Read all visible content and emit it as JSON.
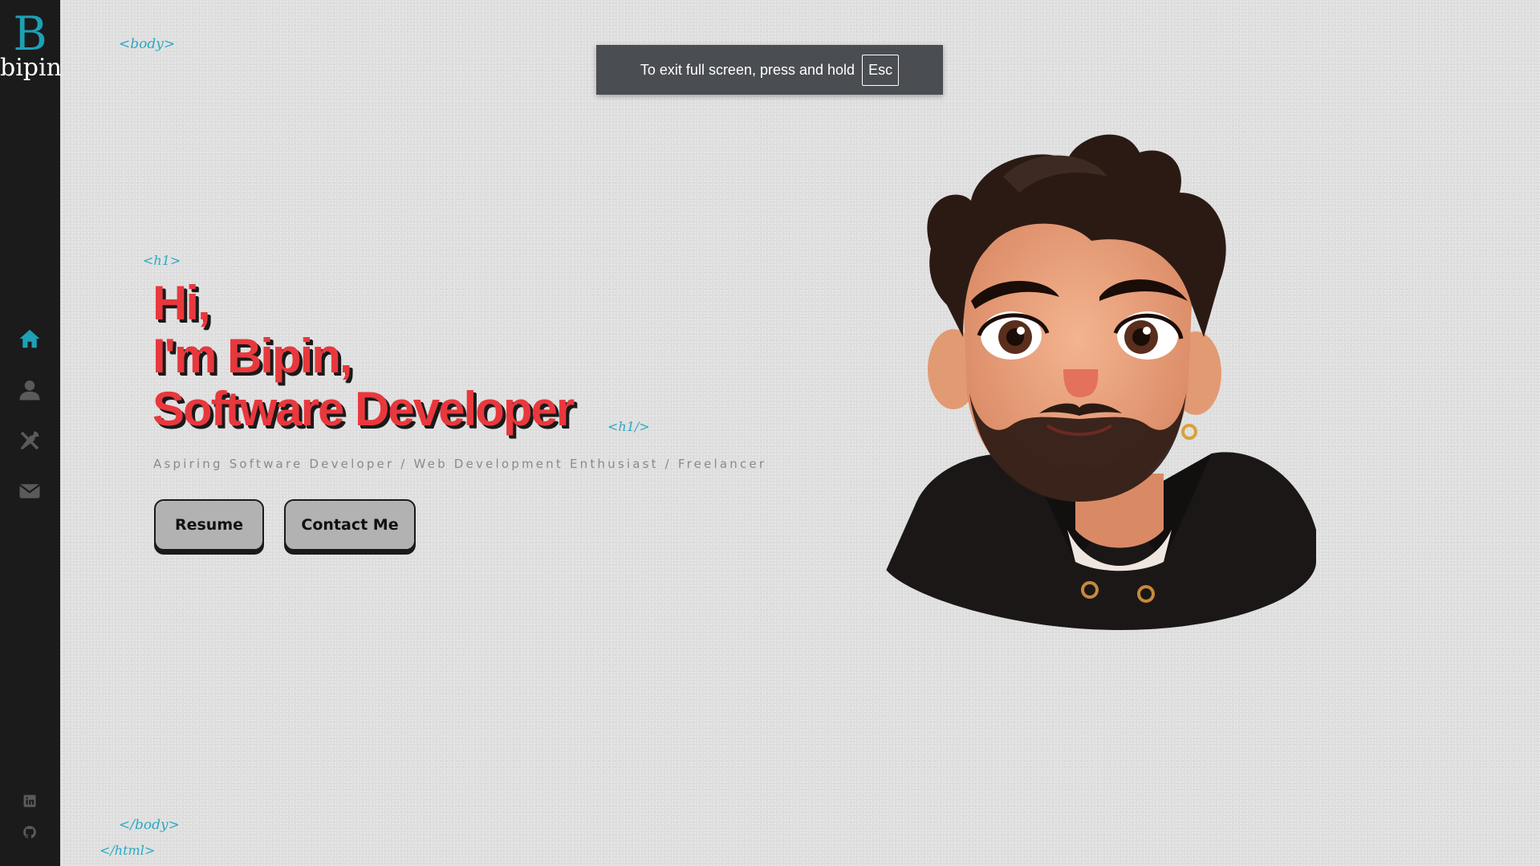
{
  "logo": {
    "letter": "B",
    "name": "bipin"
  },
  "nav": {
    "items": [
      {
        "id": "home",
        "icon": "home-icon",
        "active": true
      },
      {
        "id": "about",
        "icon": "user-icon",
        "active": false
      },
      {
        "id": "skills",
        "icon": "tools-icon",
        "active": false
      },
      {
        "id": "contact",
        "icon": "envelope-icon",
        "active": false
      }
    ]
  },
  "social": [
    {
      "id": "linkedin",
      "icon": "linkedin-icon"
    },
    {
      "id": "github",
      "icon": "github-icon"
    }
  ],
  "code_tags": {
    "body_open": "<body>",
    "h1_open": "<h1>",
    "h1_close": "<h1/>",
    "body_close": "</body>",
    "html_close": "</html>"
  },
  "fullscreen_notice": {
    "text": "To exit full screen, press and hold",
    "key": "Esc"
  },
  "hero": {
    "line1": "Hi,",
    "line2": "I'm Bipin,",
    "line3": "Software Developer",
    "subtitle": "Aspiring Software Developer / Web Development Enthusiast / Freelancer",
    "resume_label": "Resume",
    "contact_label": "Contact Me"
  },
  "colors": {
    "accent": "#1ea0b5",
    "headline": "#e8383d",
    "sidebar_bg": "#1b1b1b",
    "background": "#dedede"
  }
}
